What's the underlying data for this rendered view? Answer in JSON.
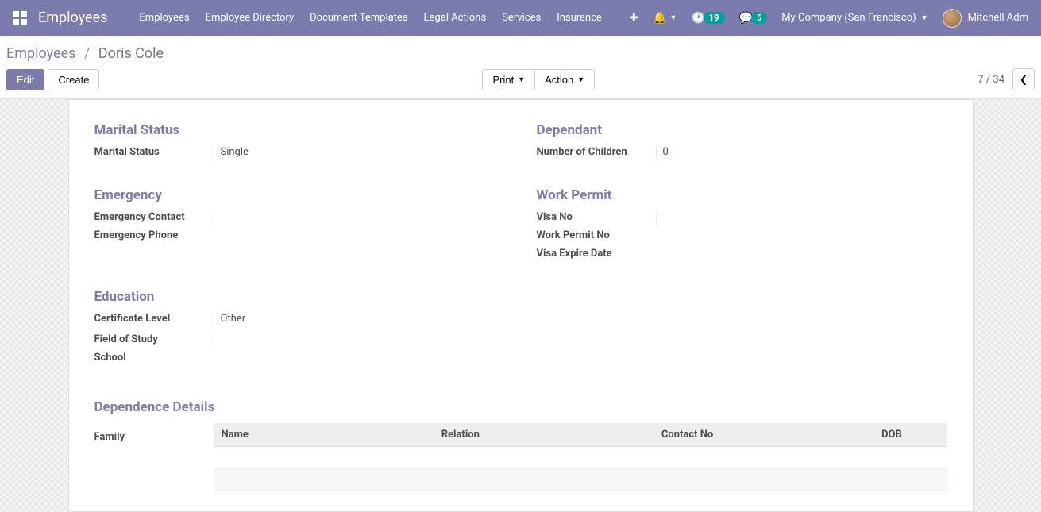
{
  "navbar": {
    "title": "Employees",
    "menu": [
      "Employees",
      "Employee Directory",
      "Document Templates",
      "Legal Actions",
      "Services",
      "Insurance"
    ],
    "badges": {
      "activities": "19",
      "messages": "5"
    },
    "company": "My Company (San Francisco)",
    "user": "Mitchell Adm"
  },
  "breadcrumb": {
    "root": "Employees",
    "current": "Doris Cole"
  },
  "buttons": {
    "edit": "Edit",
    "create": "Create",
    "print": "Print",
    "action": "Action"
  },
  "pager": {
    "text": "7 / 34"
  },
  "sections": {
    "marital_status_title": "Marital Status",
    "dependant_title": "Dependant",
    "emergency_title": "Emergency",
    "work_permit_title": "Work Permit",
    "education_title": "Education",
    "dependence_details_title": "Dependence Details"
  },
  "fields": {
    "marital_status_label": "Marital Status",
    "marital_status_value": "Single",
    "num_children_label": "Number of Children",
    "num_children_value": "0",
    "emergency_contact_label": "Emergency Contact",
    "emergency_contact_value": "",
    "emergency_phone_label": "Emergency Phone",
    "emergency_phone_value": "",
    "visa_no_label": "Visa No",
    "visa_no_value": "",
    "work_permit_no_label": "Work Permit No",
    "work_permit_no_value": "",
    "visa_expire_label": "Visa Expire Date",
    "visa_expire_value": "",
    "certificate_level_label": "Certificate Level",
    "certificate_level_value": "Other",
    "field_of_study_label": "Field of Study",
    "field_of_study_value": "",
    "school_label": "School",
    "school_value": "",
    "family_label": "Family"
  },
  "family_table": {
    "headers": [
      "Name",
      "Relation",
      "Contact No",
      "DOB"
    ],
    "rows": [
      [
        "",
        "",
        "",
        ""
      ],
      [
        "",
        "",
        "",
        ""
      ]
    ]
  }
}
